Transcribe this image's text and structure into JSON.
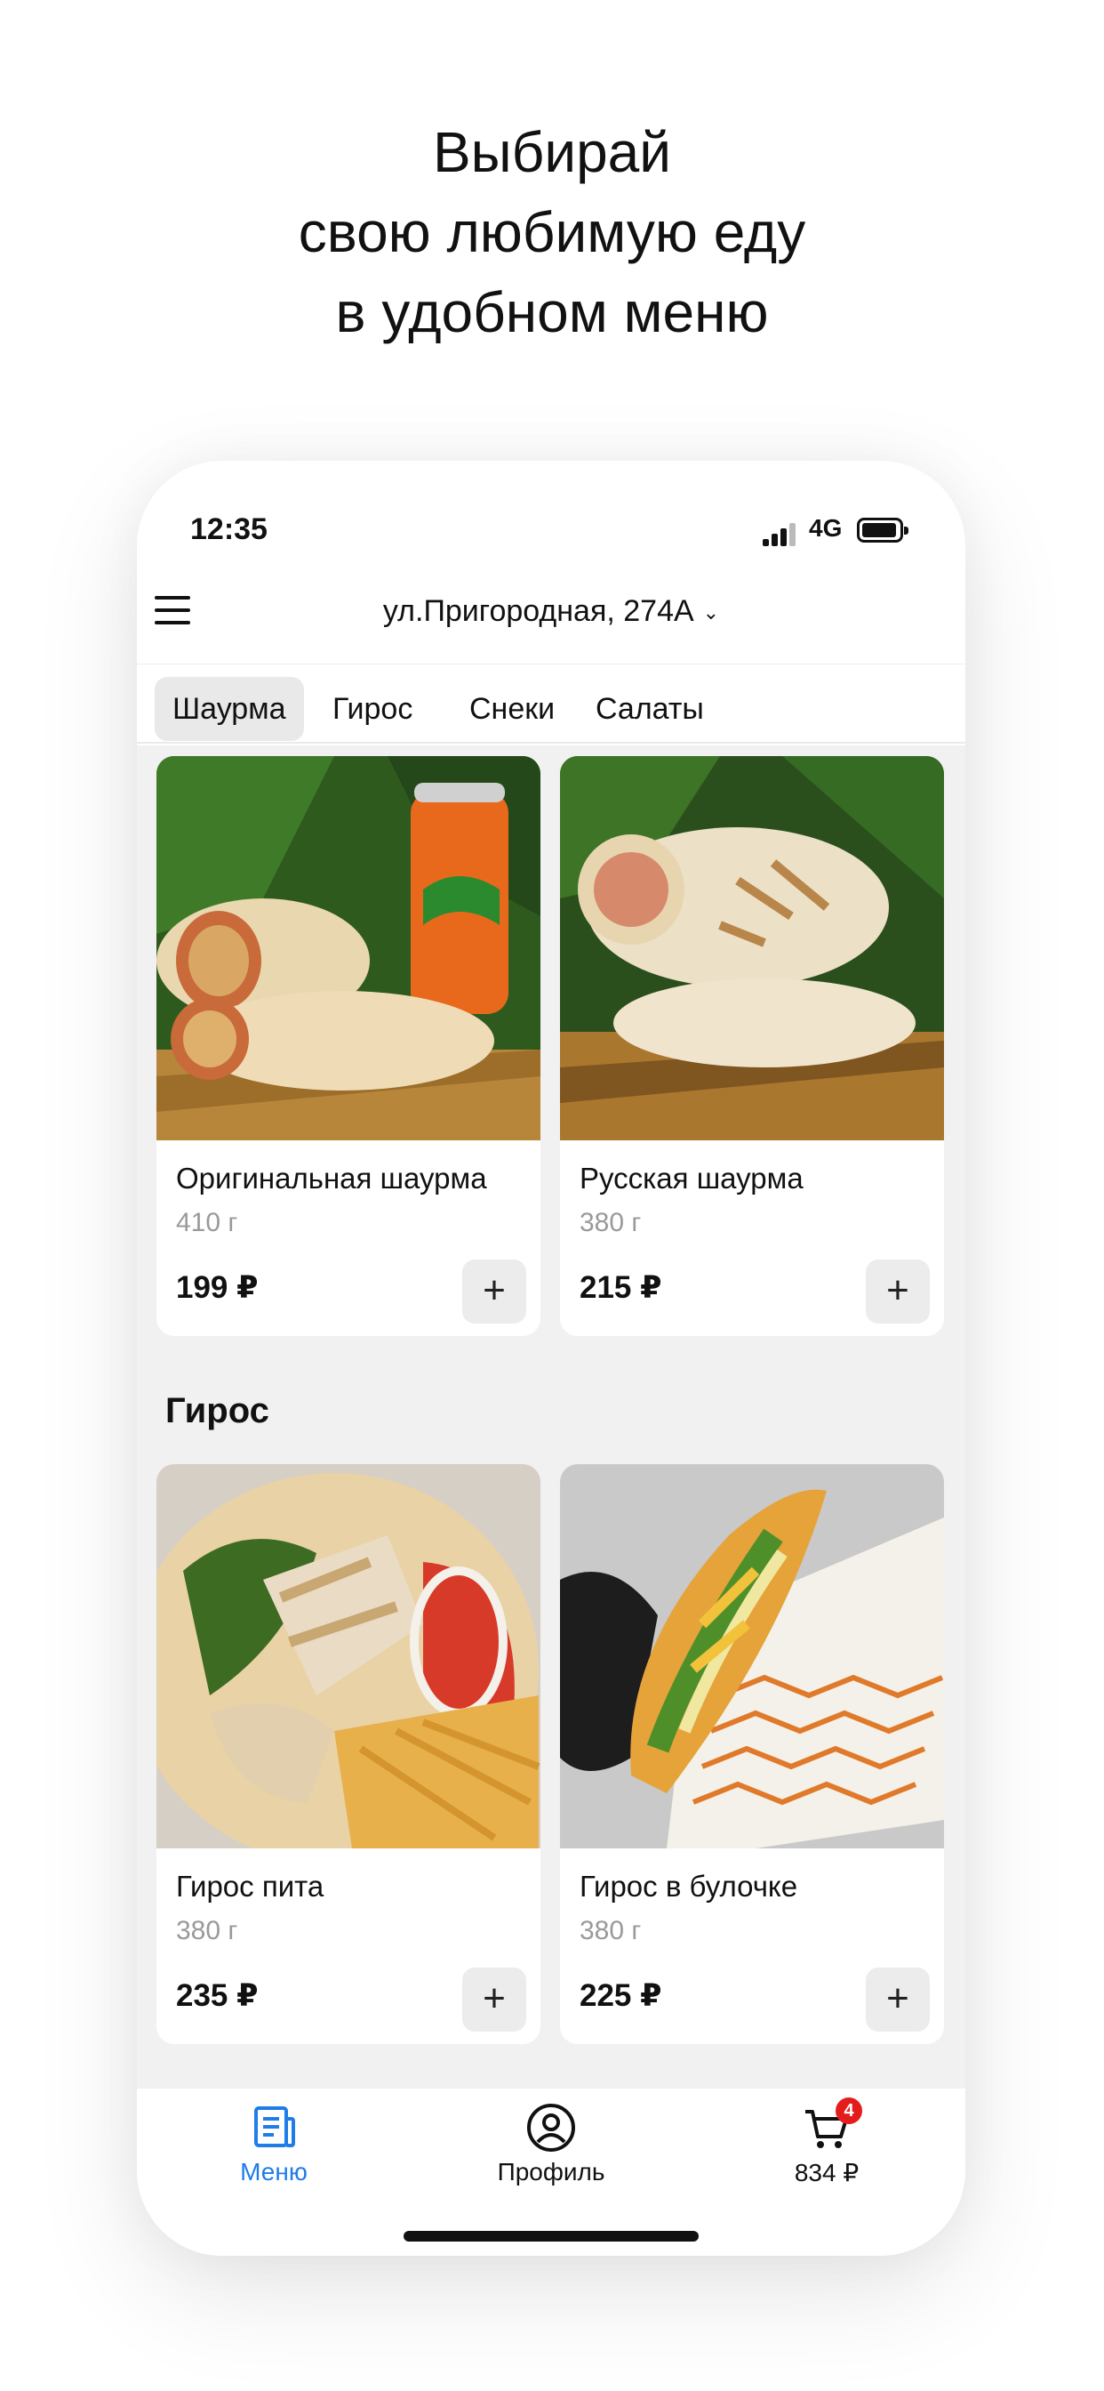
{
  "promo": {
    "line1": "Выбирай",
    "line2": "свою любимую еду",
    "line3": "в удобном меню"
  },
  "status": {
    "time": "12:35",
    "network": "4G"
  },
  "header": {
    "address": "ул.Пригородная, 274А",
    "chevron": "⌄"
  },
  "tabs": [
    {
      "label": "Шаурма",
      "active": true
    },
    {
      "label": "Гирос",
      "active": false
    },
    {
      "label": "Снеки",
      "active": false
    },
    {
      "label": "Салаты",
      "active": false
    }
  ],
  "sections": [
    {
      "title": "",
      "items": [
        {
          "name": "Оригинальная шаурма",
          "weight": "410 г",
          "price": "199 ₽",
          "add": "+"
        },
        {
          "name": "Русская шаурма",
          "weight": "380 г",
          "price": "215 ₽",
          "add": "+"
        }
      ]
    },
    {
      "title": "Гирос",
      "items": [
        {
          "name": "Гирос пита",
          "weight": "380 г",
          "price": "235 ₽",
          "add": "+"
        },
        {
          "name": "Гирос в булочке",
          "weight": "380 г",
          "price": "225 ₽",
          "add": "+"
        }
      ]
    }
  ],
  "tabbar": {
    "menu_label": "Меню",
    "profile_label": "Профиль",
    "cart_total": "834 ₽",
    "cart_count": "4"
  },
  "colors": {
    "accent": "#1f7ce8",
    "badge": "#e51c1c"
  },
  "icons": [
    "menu-icon",
    "chevron-down-icon",
    "plus-icon",
    "menu-doc-icon",
    "profile-icon",
    "cart-icon"
  ]
}
